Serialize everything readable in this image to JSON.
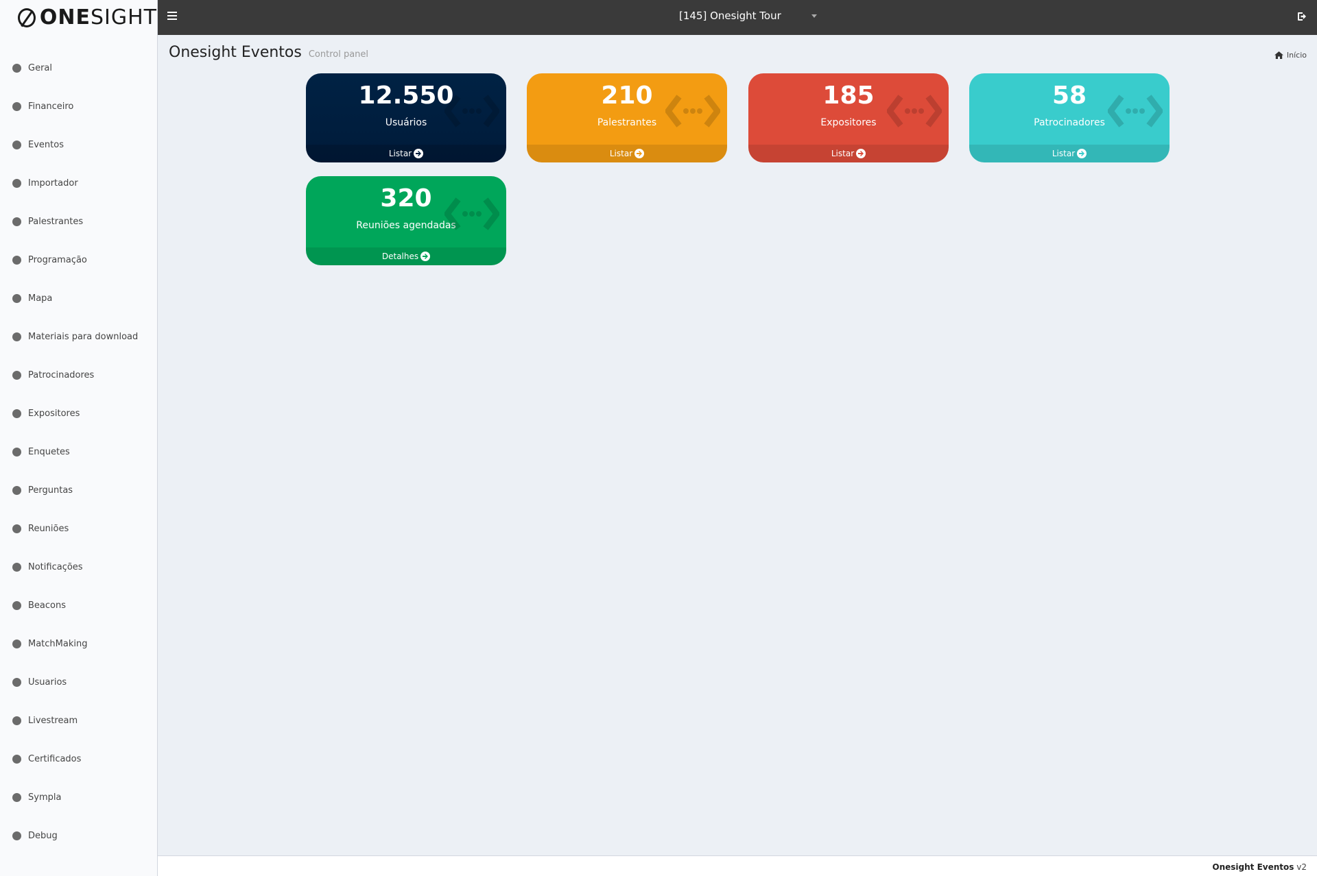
{
  "brand": {
    "logo_bold": "ONE",
    "logo_light": "SIGHT"
  },
  "sidebar": {
    "items": [
      {
        "label": "Geral"
      },
      {
        "label": "Financeiro"
      },
      {
        "label": "Eventos"
      },
      {
        "label": "Importador"
      },
      {
        "label": "Palestrantes"
      },
      {
        "label": "Programação"
      },
      {
        "label": "Mapa"
      },
      {
        "label": "Materiais para download"
      },
      {
        "label": "Patrocinadores"
      },
      {
        "label": "Expositores"
      },
      {
        "label": "Enquetes"
      },
      {
        "label": "Perguntas"
      },
      {
        "label": "Reuniões"
      },
      {
        "label": "Notificações"
      },
      {
        "label": "Beacons"
      },
      {
        "label": "MatchMaking"
      },
      {
        "label": "Usuarios"
      },
      {
        "label": "Livestream"
      },
      {
        "label": "Certificados"
      },
      {
        "label": "Sympla"
      },
      {
        "label": "Debug"
      }
    ]
  },
  "topbar": {
    "event_selected": "[145] Onesight Tour"
  },
  "header": {
    "title": "Onesight Eventos",
    "subtitle": "Control panel",
    "breadcrumb": "Início"
  },
  "cards": [
    {
      "value": "12.550",
      "caption": "Usuários",
      "link": "Listar",
      "color": "#001f3f"
    },
    {
      "value": "210",
      "caption": "Palestrantes",
      "link": "Listar",
      "color": "#f39c12"
    },
    {
      "value": "185",
      "caption": "Expositores",
      "link": "Listar",
      "color": "#dd4b39"
    },
    {
      "value": "58",
      "caption": "Patrocinadores",
      "link": "Listar",
      "color": "#39cccc"
    },
    {
      "value": "320",
      "caption": "Reuniões agendadas",
      "link": "Detalhes",
      "color": "#00a65a"
    }
  ],
  "footer": {
    "app_name": "Onesight Eventos",
    "version": "v2"
  }
}
